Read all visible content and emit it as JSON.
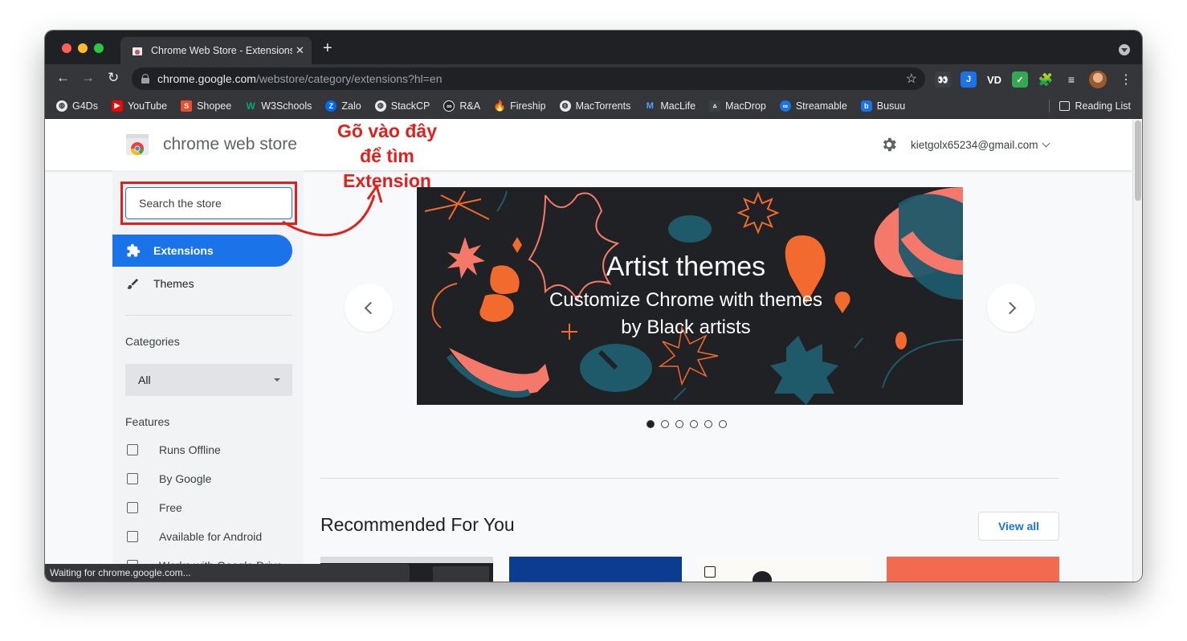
{
  "browser": {
    "tab_title": "Chrome Web Store - Extensions",
    "url_host": "chrome.google.com",
    "url_path": "/webstore/category/extensions?hl=en",
    "status_text": "Waiting for chrome.google.com..."
  },
  "bookmarks": [
    {
      "label": "G4Ds",
      "icon": "globe-icon",
      "color": "#e8eaed"
    },
    {
      "label": "YouTube",
      "icon": "youtube-icon",
      "color": "#ff0000"
    },
    {
      "label": "Shopee",
      "icon": "shopee-icon",
      "color": "#ee4d2d"
    },
    {
      "label": "W3Schools",
      "icon": "w3schools-icon",
      "color": "#04aa6d"
    },
    {
      "label": "Zalo",
      "icon": "zalo-icon",
      "color": "#0068ff"
    },
    {
      "label": "StackCP",
      "icon": "globe-icon",
      "color": "#e8eaed"
    },
    {
      "label": "R&A",
      "icon": "ra-icon",
      "color": "#202124"
    },
    {
      "label": "Fireship",
      "icon": "fire-icon",
      "color": "#f4511e"
    },
    {
      "label": "MacTorrents",
      "icon": "globe-icon",
      "color": "#e8eaed"
    },
    {
      "label": "MacLife",
      "icon": "maclife-icon",
      "color": "#1a73e8"
    },
    {
      "label": "MacDrop",
      "icon": "macdrop-icon",
      "color": "#5f6368"
    },
    {
      "label": "Streamable",
      "icon": "streamable-icon",
      "color": "#1a73e8"
    },
    {
      "label": "Busuu",
      "icon": "busuu-icon",
      "color": "#1a73e8"
    }
  ],
  "reading_list": "Reading List",
  "store": {
    "name": "chrome web store",
    "account": "kietgolx65234@gmail.com"
  },
  "sidebar": {
    "search_placeholder": "Search the store",
    "nav": [
      {
        "label": "Extensions",
        "icon": "puzzle-icon",
        "active": true
      },
      {
        "label": "Themes",
        "icon": "brush-icon",
        "active": false
      }
    ],
    "categories_title": "Categories",
    "category_selected": "All",
    "features_title": "Features",
    "features": [
      "Runs Offline",
      "By Google",
      "Free",
      "Available for Android",
      "Works with Google Drive"
    ]
  },
  "banner": {
    "title": "Artist themes",
    "subtitle_line1": "Customize Chrome with themes",
    "subtitle_line2": "by Black artists",
    "slide_count": 6,
    "active_slide": 0
  },
  "main": {
    "section_title": "Recommended For You",
    "view_all": "View all"
  },
  "annotation": {
    "line1": "Gõ vào đây",
    "line2": "để tìm",
    "line3": "Extension",
    "color": "#e0201d"
  }
}
